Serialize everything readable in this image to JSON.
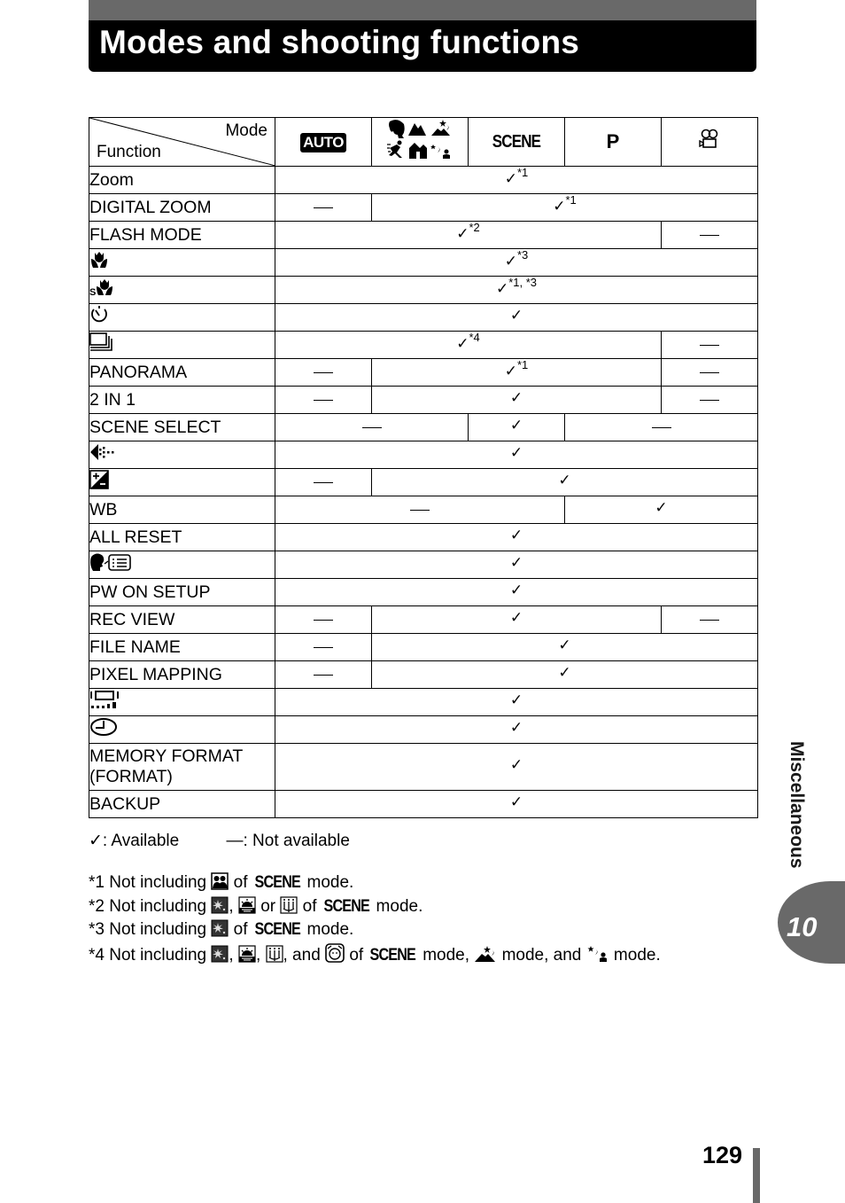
{
  "page_title": "Modes and shooting functions",
  "table": {
    "corner_mode_label": "Mode",
    "corner_function_label": "Function",
    "modes": [
      {
        "id": "auto",
        "label": "AUTO",
        "icon": "auto-mode-icon"
      },
      {
        "id": "scene-icons",
        "label": "",
        "icon": "portrait-landscape-landscape-portrait-sport-indoor-night-scene-night-portrait-icons"
      },
      {
        "id": "scene",
        "label": "SCENE",
        "icon": "scene-mode-icon"
      },
      {
        "id": "p",
        "label": "P",
        "icon": "program-mode-icon"
      },
      {
        "id": "movie",
        "label": "",
        "icon": "movie-camera-icon"
      }
    ],
    "available_symbol": "✓",
    "rows": [
      {
        "function": "Zoom",
        "cells": [
          {
            "span": 5,
            "value": "✓",
            "note": "*1"
          }
        ]
      },
      {
        "function": "DIGITAL ZOOM",
        "cells": [
          {
            "span": 1,
            "value": "—"
          },
          {
            "span": 4,
            "value": "✓",
            "note": "*1"
          }
        ]
      },
      {
        "function": "FLASH MODE",
        "cells": [
          {
            "span": 4,
            "value": "✓",
            "note": "*2"
          },
          {
            "span": 1,
            "value": "—"
          }
        ]
      },
      {
        "function": "",
        "icon": "macro-icon",
        "cells": [
          {
            "span": 5,
            "value": "✓",
            "note": "*3"
          }
        ]
      },
      {
        "function": "",
        "icon": "super-macro-icon",
        "cells": [
          {
            "span": 5,
            "value": "✓",
            "note": "*1, *3"
          }
        ]
      },
      {
        "function": "",
        "icon": "self-timer-icon",
        "cells": [
          {
            "span": 5,
            "value": "✓"
          }
        ]
      },
      {
        "function": "",
        "icon": "sequential-shooting-icon",
        "cells": [
          {
            "span": 4,
            "value": "✓",
            "note": "*4"
          },
          {
            "span": 1,
            "value": "—"
          }
        ]
      },
      {
        "function": "PANORAMA",
        "cells": [
          {
            "span": 1,
            "value": "—"
          },
          {
            "span": 3,
            "value": "✓",
            "note": "*1"
          },
          {
            "span": 1,
            "value": "—"
          }
        ]
      },
      {
        "function": "2 IN 1",
        "cells": [
          {
            "span": 1,
            "value": "—"
          },
          {
            "span": 3,
            "value": "✓"
          },
          {
            "span": 1,
            "value": "—"
          }
        ]
      },
      {
        "function": "SCENE SELECT",
        "cells": [
          {
            "span": 2,
            "value": "—"
          },
          {
            "span": 1,
            "value": "✓"
          },
          {
            "span": 2,
            "value": "—"
          }
        ]
      },
      {
        "function": "",
        "icon": "image-quality-icon",
        "cells": [
          {
            "span": 5,
            "value": "✓"
          }
        ]
      },
      {
        "function": "",
        "icon": "exposure-compensation-icon",
        "cells": [
          {
            "span": 1,
            "value": "—"
          },
          {
            "span": 4,
            "value": "✓"
          }
        ]
      },
      {
        "function": "WB",
        "cells": [
          {
            "span": 3,
            "value": "—"
          },
          {
            "span": 2,
            "value": "✓"
          }
        ]
      },
      {
        "function": "ALL RESET",
        "cells": [
          {
            "span": 5,
            "value": "✓"
          }
        ]
      },
      {
        "function": "",
        "icon": "language-icon",
        "cells": [
          {
            "span": 5,
            "value": "✓"
          }
        ]
      },
      {
        "function": "PW ON SETUP",
        "cells": [
          {
            "span": 5,
            "value": "✓"
          }
        ]
      },
      {
        "function": "REC VIEW",
        "cells": [
          {
            "span": 1,
            "value": "—"
          },
          {
            "span": 3,
            "value": "✓"
          },
          {
            "span": 1,
            "value": "—"
          }
        ]
      },
      {
        "function": "FILE NAME",
        "cells": [
          {
            "span": 1,
            "value": "—"
          },
          {
            "span": 4,
            "value": "✓"
          }
        ]
      },
      {
        "function": "PIXEL MAPPING",
        "cells": [
          {
            "span": 1,
            "value": "—"
          },
          {
            "span": 4,
            "value": "✓"
          }
        ]
      },
      {
        "function": "",
        "icon": "monitor-brightness-icon",
        "cells": [
          {
            "span": 5,
            "value": "✓"
          }
        ]
      },
      {
        "function": "",
        "icon": "date-time-icon",
        "cells": [
          {
            "span": 5,
            "value": "✓"
          }
        ]
      },
      {
        "function": "MEMORY FORMAT\n(FORMAT)",
        "tall": true,
        "cells": [
          {
            "span": 5,
            "value": "✓"
          }
        ]
      },
      {
        "function": "BACKUP",
        "cells": [
          {
            "span": 5,
            "value": "✓"
          }
        ]
      }
    ]
  },
  "legend": {
    "available": "✓: Available",
    "not_available": "—: Not available"
  },
  "notes": [
    {
      "id": "*1",
      "parts": [
        {
          "t": "*1 Not including "
        },
        {
          "icon": "two-in-one-portrait-icon"
        },
        {
          "t": " of "
        },
        {
          "scene": "SCENE"
        },
        {
          "t": " mode."
        }
      ]
    },
    {
      "id": "*2",
      "parts": [
        {
          "t": "*2 Not including "
        },
        {
          "icon": "fireworks-icon"
        },
        {
          "t": ", "
        },
        {
          "icon": "sunset-icon"
        },
        {
          "t": " or "
        },
        {
          "icon": "candle-icon"
        },
        {
          "t": " of "
        },
        {
          "scene": "SCENE"
        },
        {
          "t": " mode."
        }
      ]
    },
    {
      "id": "*3",
      "parts": [
        {
          "t": "*3 Not including "
        },
        {
          "icon": "fireworks-icon"
        },
        {
          "t": " of "
        },
        {
          "scene": "SCENE"
        },
        {
          "t": " mode."
        }
      ]
    },
    {
      "id": "*4",
      "parts": [
        {
          "t": "*4 Not including "
        },
        {
          "icon": "fireworks-icon"
        },
        {
          "t": ", "
        },
        {
          "icon": "sunset-icon"
        },
        {
          "t": ", "
        },
        {
          "icon": "candle-icon"
        },
        {
          "t": ", and "
        },
        {
          "icon": "self-portrait-icon"
        },
        {
          "t": " of "
        },
        {
          "scene": "SCENE"
        },
        {
          "t": " mode, "
        },
        {
          "icon": "night-scene-icon"
        },
        {
          "t": " mode, and "
        },
        {
          "icon": "night-portrait-icon"
        },
        {
          "t": " mode."
        }
      ]
    }
  ],
  "side_tab": {
    "section_label": "Miscellaneous",
    "chapter_number": "10"
  },
  "page_number": "129"
}
